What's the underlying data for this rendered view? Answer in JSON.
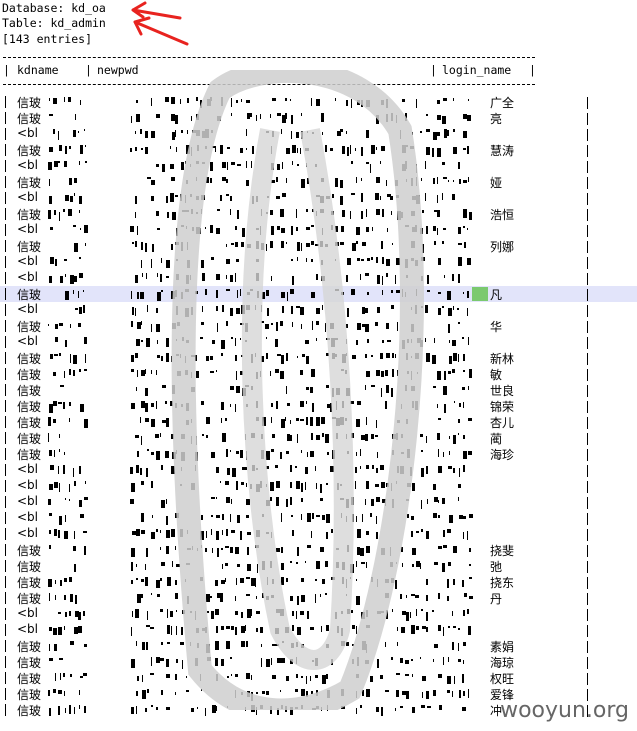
{
  "header": {
    "database_line": "Database: kd_oa",
    "table_line": "Table: kd_admin",
    "entries_line": "[143 entries]"
  },
  "columns": [
    "kdname",
    "newpwd",
    "login_name"
  ],
  "accent": {
    "arrow": "#e8231f",
    "highlight": "#7bc96f",
    "selected_row": "#e2e4fa"
  },
  "rows": [
    {
      "kd": "信玻",
      "name": "广全"
    },
    {
      "kd": "信玻",
      "name": "亮"
    },
    {
      "kd": "<bl",
      "name": ""
    },
    {
      "kd": "信玻",
      "name": "慧涛"
    },
    {
      "kd": "<bl",
      "name": ""
    },
    {
      "kd": "信玻",
      "name": "娅"
    },
    {
      "kd": "<bl",
      "name": ""
    },
    {
      "kd": "信玻",
      "name": "浩恒"
    },
    {
      "kd": "<bl",
      "name": ""
    },
    {
      "kd": "信玻",
      "name": "列娜"
    },
    {
      "kd": "<bl",
      "name": ""
    },
    {
      "kd": "<bl",
      "name": ""
    },
    {
      "kd": "信玻",
      "name": "凡",
      "selected": true
    },
    {
      "kd": "<bl",
      "name": ""
    },
    {
      "kd": "信玻",
      "name": "华"
    },
    {
      "kd": "<bl",
      "name": ""
    },
    {
      "kd": "信玻",
      "name": "新林"
    },
    {
      "kd": "信玻",
      "name": "敏"
    },
    {
      "kd": "信玻",
      "name": "世良"
    },
    {
      "kd": "信玻",
      "name": "锦荣"
    },
    {
      "kd": "信玻",
      "name": "杏儿"
    },
    {
      "kd": "信玻",
      "name": "蔺"
    },
    {
      "kd": "信玻",
      "name": "海珍"
    },
    {
      "kd": "<bl",
      "name": ""
    },
    {
      "kd": "<bl",
      "name": ""
    },
    {
      "kd": "<bl",
      "name": ""
    },
    {
      "kd": "<bl",
      "name": ""
    },
    {
      "kd": "<bl",
      "name": ""
    },
    {
      "kd": "信玻",
      "name": "挠斐"
    },
    {
      "kd": "信玻",
      "name": "弛"
    },
    {
      "kd": "信玻",
      "name": "挠东"
    },
    {
      "kd": "信玻",
      "name": "丹"
    },
    {
      "kd": "<bl",
      "name": ""
    },
    {
      "kd": "<bl",
      "name": ""
    },
    {
      "kd": "信玻",
      "name": "素娟"
    },
    {
      "kd": "信玻",
      "name": "海琼"
    },
    {
      "kd": "信玻",
      "name": "权旺"
    },
    {
      "kd": "信玻",
      "name": "爱锋"
    },
    {
      "kd": "信玻",
      "name": "冲"
    }
  ],
  "watermark": "wooyun.org"
}
